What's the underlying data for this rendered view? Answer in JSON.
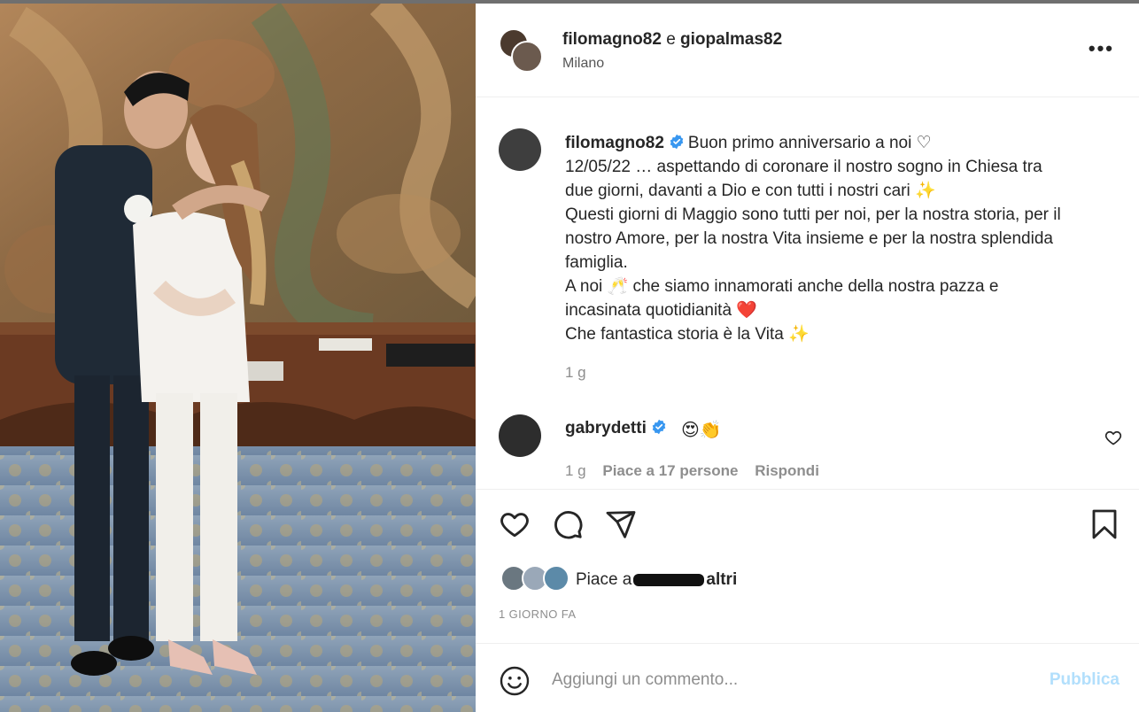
{
  "post": {
    "owner1": "filomagno82",
    "connector": "e",
    "owner2": "giopalmas82",
    "location": "Milano",
    "more_label": "•••"
  },
  "caption": {
    "user": "filomagno82",
    "line1": "Buon primo anniversario a noi ♡",
    "body": "12/05/22 … aspettando di coronare il nostro sogno in Chiesa tra\ndue giorni, davanti a Dio e con tutti i nostri cari ✨\nQuesti giorni di Maggio sono tutti per noi, per la nostra storia, per il\nnostro Amore, per la nostra Vita insieme e per la nostra splendida\nfamiglia.\nA noi 🥂 che siamo innamorati anche della nostra pazza e\nincasinata quotidianità ❤️\nChe fantastica storia è la Vita ✨",
    "time": "1 g"
  },
  "comment": {
    "user": "gabrydetti",
    "text": "😍👏",
    "time": "1 g",
    "likes": "Piace a 17 persone",
    "reply": "Rispondi"
  },
  "likes": {
    "prefix": "Piace a",
    "suffix": "altri"
  },
  "date": "1 GIORNO FA",
  "composer": {
    "placeholder": "Aggiungi un commento...",
    "publish": "Pubblica"
  },
  "colors": {
    "verified": "#3897f0",
    "publish_disabled": "#b2dffc",
    "muted": "#8e8e8e"
  },
  "icons": [
    "heart-icon",
    "comment-icon",
    "share-icon",
    "bookmark-icon",
    "emoji-icon",
    "verified-icon",
    "more-icon"
  ]
}
